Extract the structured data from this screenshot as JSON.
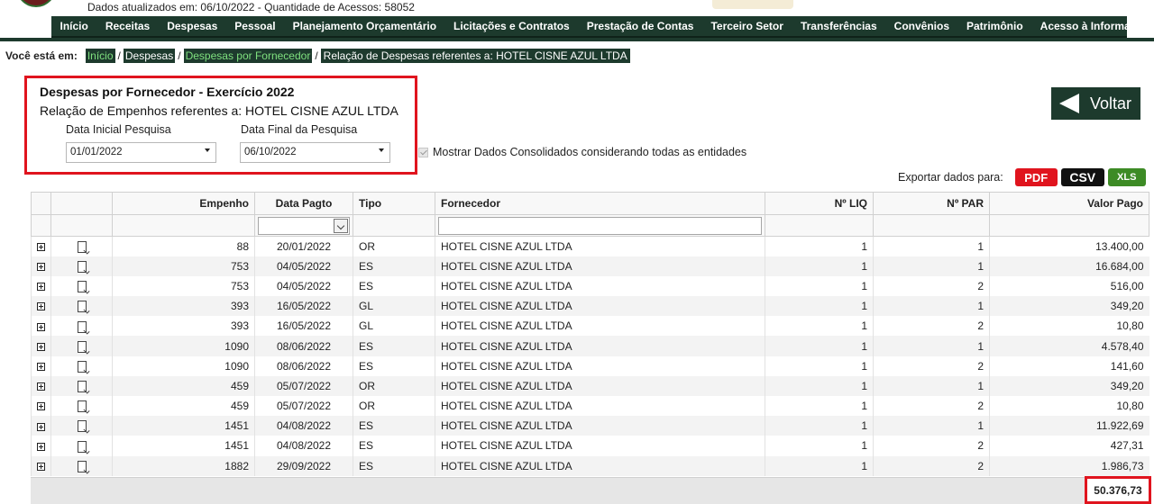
{
  "header": {
    "info": "Dados atualizados em: 06/10/2022 - Quantidade de Acessos: 58052"
  },
  "nav": {
    "items": [
      "Início",
      "Receitas",
      "Despesas",
      "Pessoal",
      "Planejamento Orçamentário",
      "Licitações e Contratos",
      "Prestação de Contas",
      "Terceiro Setor",
      "Transferências",
      "Convênios",
      "Patrimônio",
      "Acesso à Informação"
    ]
  },
  "breadcrumb": {
    "prefix": "Você está em:",
    "items": [
      "Início",
      "Despesas",
      "Despesas por Fornecedor"
    ],
    "current": "Relação de Despesas referentes a: HOTEL CISNE AZUL LTDA"
  },
  "filter": {
    "title": "Despesas por Fornecedor - Exercício 2022",
    "subtitle": "Relação de Empenhos referentes a: HOTEL CISNE AZUL LTDA",
    "start_label": "Data Inicial Pesquisa",
    "end_label": "Data Final da Pesquisa",
    "start_value": "01/01/2022",
    "end_value": "06/10/2022",
    "consolidated_label": "Mostrar Dados Consolidados considerando todas as entidades",
    "consolidated_checked": true
  },
  "voltar_label": "Voltar",
  "export": {
    "label": "Exportar dados para:",
    "pdf": "PDF",
    "csv": "CSV",
    "xls": "XLS"
  },
  "table": {
    "columns": [
      "Empenho",
      "Data Pagto",
      "Tipo",
      "Fornecedor",
      "Nº LIQ",
      "Nº PAR",
      "Valor Pago"
    ],
    "rows": [
      [
        "88",
        "20/01/2022",
        "OR",
        "HOTEL CISNE AZUL LTDA",
        "1",
        "1",
        "13.400,00"
      ],
      [
        "753",
        "04/05/2022",
        "ES",
        "HOTEL CISNE AZUL LTDA",
        "1",
        "1",
        "16.684,00"
      ],
      [
        "753",
        "04/05/2022",
        "ES",
        "HOTEL CISNE AZUL LTDA",
        "1",
        "2",
        "516,00"
      ],
      [
        "393",
        "16/05/2022",
        "GL",
        "HOTEL CISNE AZUL LTDA",
        "1",
        "1",
        "349,20"
      ],
      [
        "393",
        "16/05/2022",
        "GL",
        "HOTEL CISNE AZUL LTDA",
        "1",
        "2",
        "10,80"
      ],
      [
        "1090",
        "08/06/2022",
        "ES",
        "HOTEL CISNE AZUL LTDA",
        "1",
        "1",
        "4.578,40"
      ],
      [
        "1090",
        "08/06/2022",
        "ES",
        "HOTEL CISNE AZUL LTDA",
        "1",
        "2",
        "141,60"
      ],
      [
        "459",
        "05/07/2022",
        "OR",
        "HOTEL CISNE AZUL LTDA",
        "1",
        "1",
        "349,20"
      ],
      [
        "459",
        "05/07/2022",
        "OR",
        "HOTEL CISNE AZUL LTDA",
        "1",
        "2",
        "10,80"
      ],
      [
        "1451",
        "04/08/2022",
        "ES",
        "HOTEL CISNE AZUL LTDA",
        "1",
        "1",
        "11.922,69"
      ],
      [
        "1451",
        "04/08/2022",
        "ES",
        "HOTEL CISNE AZUL LTDA",
        "1",
        "2",
        "427,31"
      ],
      [
        "1882",
        "29/09/2022",
        "ES",
        "HOTEL CISNE AZUL LTDA",
        "1",
        "2",
        "1.986,73"
      ]
    ],
    "total": "50.376,73"
  },
  "colors": {
    "nav_bg": "#1d3a2d",
    "highlight": "#e0141e",
    "link_green": "#7fe07f"
  }
}
